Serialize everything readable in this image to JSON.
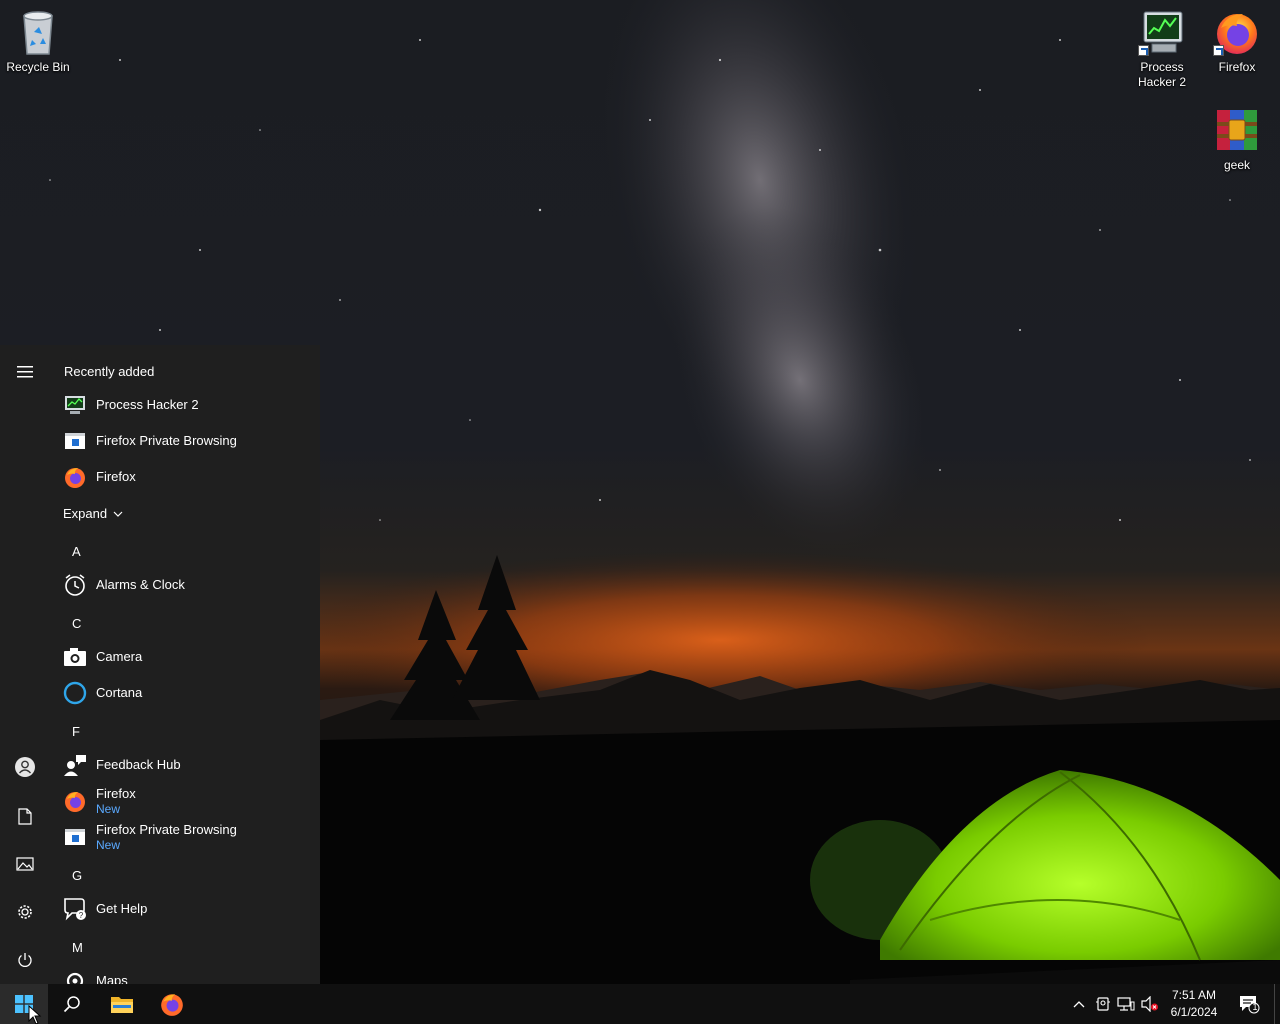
{
  "desktop": {
    "icons": [
      {
        "label": "Recycle Bin",
        "icon": "recycle-bin-icon"
      },
      {
        "label_line1": "Process",
        "label_line2": "Hacker 2",
        "icon": "process-hacker-icon"
      },
      {
        "label": "Firefox",
        "icon": "firefox-icon"
      },
      {
        "label": "geek",
        "icon": "winrar-archive-icon"
      }
    ]
  },
  "start_menu": {
    "recently_added_title": "Recently added",
    "recent": [
      {
        "label": "Process Hacker 2",
        "icon": "process-hacker-icon"
      },
      {
        "label": "Firefox Private Browsing",
        "icon": "firefox-private-icon"
      },
      {
        "label": "Firefox",
        "icon": "firefox-icon"
      }
    ],
    "expand_label": "Expand",
    "groups": [
      {
        "letter": "A",
        "apps": [
          {
            "label": "Alarms & Clock",
            "icon": "alarm-clock-icon"
          }
        ]
      },
      {
        "letter": "C",
        "apps": [
          {
            "label": "Camera",
            "icon": "camera-icon"
          },
          {
            "label": "Cortana",
            "icon": "cortana-icon"
          }
        ]
      },
      {
        "letter": "F",
        "apps": [
          {
            "label": "Feedback Hub",
            "icon": "feedback-hub-icon"
          },
          {
            "label": "Firefox",
            "sub": "New",
            "icon": "firefox-icon"
          },
          {
            "label": "Firefox Private Browsing",
            "sub": "New",
            "icon": "firefox-private-icon"
          }
        ]
      },
      {
        "letter": "G",
        "apps": [
          {
            "label": "Get Help",
            "icon": "get-help-icon"
          }
        ]
      },
      {
        "letter": "M",
        "apps": [
          {
            "label": "Maps",
            "icon": "maps-icon"
          }
        ]
      }
    ],
    "rail": [
      "hamburger-menu-icon",
      "user-account-icon",
      "documents-icon",
      "pictures-icon",
      "settings-gear-icon",
      "power-icon"
    ]
  },
  "taskbar": {
    "pinned": [
      "start-windows-icon",
      "search-icon",
      "file-explorer-icon",
      "firefox-icon"
    ],
    "tray": [
      "show-hidden-icons-chevron-icon",
      "meet-now-icon",
      "network-icon",
      "volume-muted-icon"
    ],
    "time": "7:51 AM",
    "date": "6/1/2024",
    "notification_count": "1"
  },
  "colors": {
    "start_menu_bg": "#1f1f1f",
    "taskbar_bg": "#101010",
    "accent_blue": "#5aa9ff",
    "tent_green": "#8fe000",
    "glow_orange": "#e0621a"
  }
}
